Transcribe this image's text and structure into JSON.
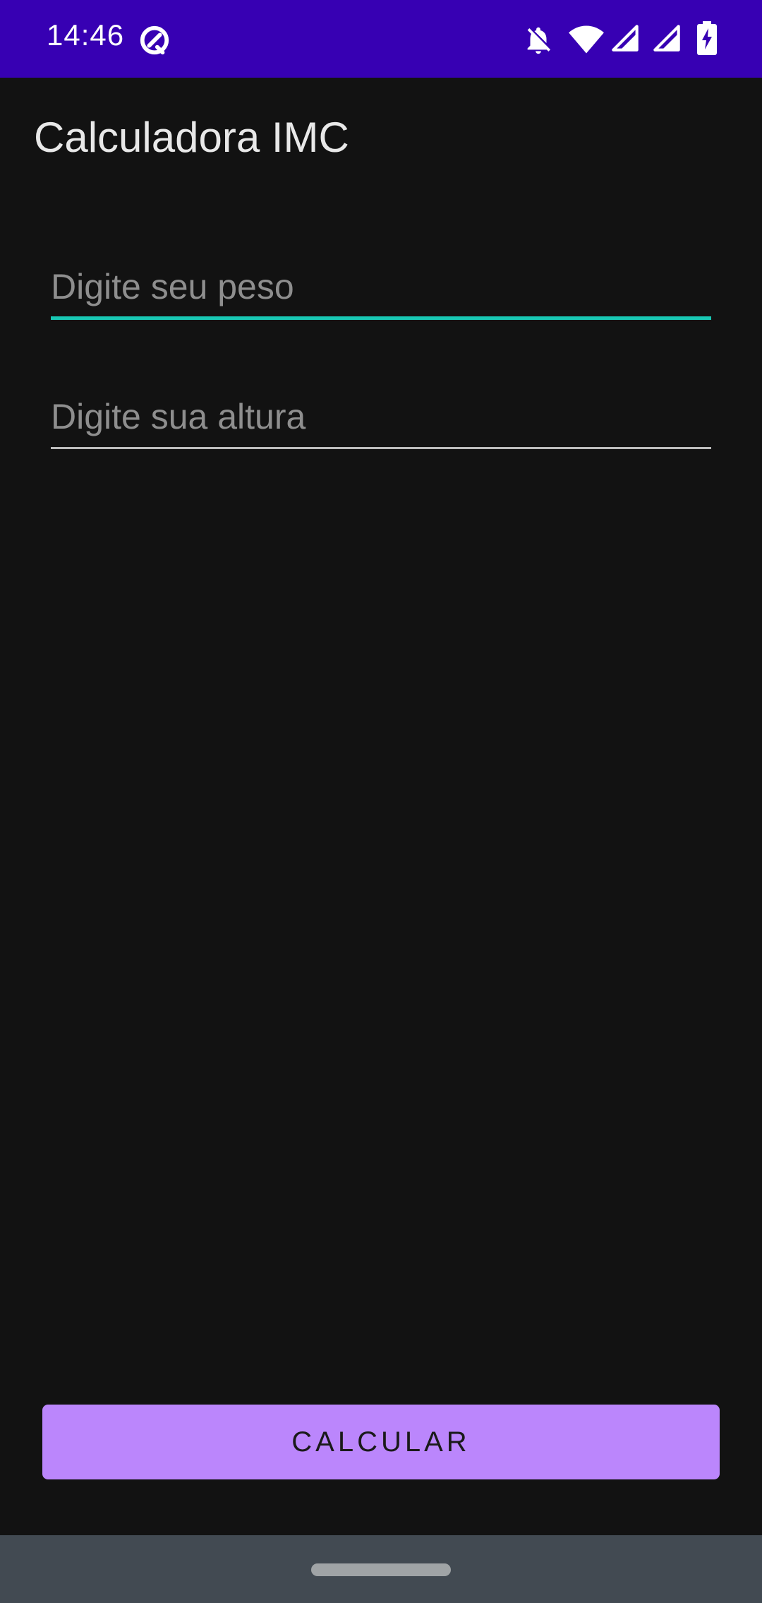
{
  "status_bar": {
    "time": "14:46",
    "background": "#3700b3",
    "icons": [
      "app-notification-icon",
      "bell-off-icon",
      "wifi-icon",
      "cell-signal-icon",
      "cell-signal-icon",
      "battery-charging-icon"
    ]
  },
  "app": {
    "title": "Calculadora IMC"
  },
  "form": {
    "weight": {
      "value": "",
      "placeholder": "Digite seu peso",
      "focused": true
    },
    "height": {
      "value": "",
      "placeholder": "Digite sua altura",
      "focused": false
    },
    "calculate_label": "CALCULAR"
  },
  "colors": {
    "background": "#121212",
    "accent_focus": "#18c8b4",
    "button": "#bb86fc",
    "nav_bar": "#424a52"
  }
}
